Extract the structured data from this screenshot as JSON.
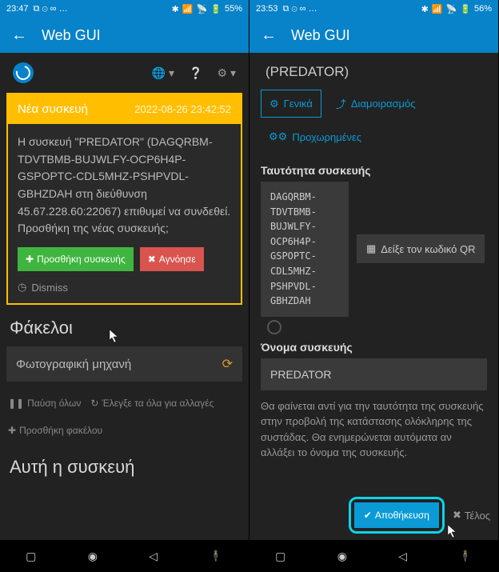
{
  "left": {
    "statusbar": {
      "time": "23:47",
      "battery": "55%",
      "icons": "⧉ ⊙ ∞ …",
      "sig": "⁂ ▮▮▮ ⋮⋮"
    },
    "appbar": {
      "back": "←",
      "title": "Web GUI"
    },
    "topicons": {
      "globe": "🌐 ▾",
      "help": "❔",
      "gear": "⚙ ▾"
    },
    "alert": {
      "title": "Νέα συσκευή",
      "date": "2022-08-26 23:42:52",
      "body": "Η συσκευή \"PREDATOR\" (DAGQRBM-TDVTBMB-BUJWLFY-OCP6H4P-GSPOPTC-CDL5MHZ-PSHPVDL-GBHZDAH στη διεύθυνση 45.67.228.60:22067) επιθυμεί να συνδεθεί. Προσθήκη της νέας συσκευής;",
      "add": "Προσθήκη συσκευής",
      "ignore": "Αγνόησε",
      "dismiss": "Dismiss"
    },
    "folders": {
      "heading": "Φάκελοι",
      "item": "Φωτογραφική μηχανή"
    },
    "links": {
      "pause": "Παύση όλων",
      "scan": "Έλεγξε τα όλα για αλλαγές",
      "addfolder": "Προσθήκη φακέλου"
    },
    "thisdev": "Αυτή η συσκευή"
  },
  "right": {
    "statusbar": {
      "time": "23:53",
      "battery": "56%",
      "icons": "⧉ ⊙ ∞ …"
    },
    "appbar": {
      "back": "←",
      "title": "Web GUI"
    },
    "subtitle": "(PREDATOR)",
    "tabs": {
      "general": "Γενικά",
      "sharing": "Διαμοιρασμός",
      "advanced": "Προχωρημένες"
    },
    "idlabel": "Ταυτότητα συσκευής",
    "device_id": "DAGQRBM-\nTDVTBMB-\nBUJWLFY-\nOCP6H4P-\nGSPOPTC-\nCDL5MHZ-\nPSHPVDL-\nGBHZDAH",
    "qr": "Δείξε τον κωδικό QR",
    "namelabel": "Όνομα συσκευής",
    "name": "PREDATOR",
    "help": "Θα φαίνεται αντί για την ταυτότητα της συσκευής στην προβολή της κατάστασης ολόκληρης της συστάδας. Θα ενημερώνεται αυτόματα αν αλλάξει το όνομα της συσκευής.",
    "save": "Αποθήκευση",
    "close": "Τέλος"
  }
}
